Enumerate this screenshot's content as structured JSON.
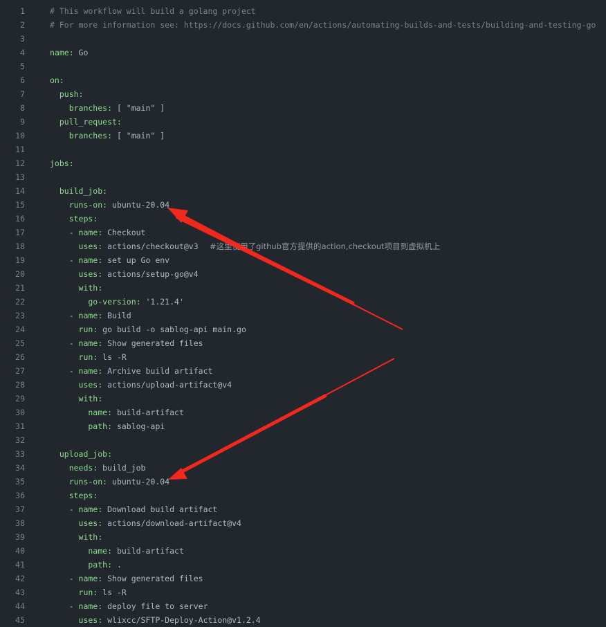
{
  "line_numbers": [
    "1",
    "2",
    "3",
    "4",
    "5",
    "6",
    "7",
    "8",
    "9",
    "10",
    "11",
    "12",
    "13",
    "14",
    "15",
    "16",
    "17",
    "18",
    "19",
    "20",
    "21",
    "22",
    "23",
    "24",
    "25",
    "26",
    "27",
    "28",
    "29",
    "30",
    "31",
    "32",
    "33",
    "34",
    "35",
    "36",
    "37",
    "38",
    "39",
    "40",
    "41",
    "42",
    "43",
    "44",
    "45"
  ],
  "code": {
    "l1": "# This workflow will build a golang project",
    "l2": "# For more information see: https://docs.github.com/en/actions/automating-builds-and-tests/building-and-testing-go",
    "l4k": "name:",
    "l4v": " Go",
    "l6k": "on:",
    "l7k": "  push:",
    "l8k": "    branches:",
    "l8v": " [ \"main\" ]",
    "l9k": "  pull_request:",
    "l10k": "    branches:",
    "l10v": " [ \"main\" ]",
    "l12k": "jobs:",
    "l14k": "  build_job:",
    "l15k": "    runs-on:",
    "l15v": " ubuntu-20.04",
    "l16k": "    steps:",
    "l17p": "    - ",
    "l17k": "name:",
    "l17v": " Checkout",
    "l18k": "      uses:",
    "l18v": " actions/checkout@v3",
    "l18note": "#这里使用了github官方提供的action,checkout项目到虚拟机上",
    "l19p": "    - ",
    "l19k": "name:",
    "l19v": " set up Go env",
    "l20k": "      uses:",
    "l20v": " actions/setup-go@v4",
    "l21k": "      with:",
    "l22k": "        go-version:",
    "l22v": " '1.21.4'",
    "l23p": "    - ",
    "l23k": "name:",
    "l23v": " Build",
    "l24k": "      run:",
    "l24v": " go build -o sablog-api main.go",
    "l25p": "    - ",
    "l25k": "name:",
    "l25v": " Show generated files",
    "l26k": "      run:",
    "l26v": " ls -R",
    "l27p": "    - ",
    "l27k": "name:",
    "l27v": " Archive build artifact",
    "l28k": "      uses:",
    "l28v": " actions/upload-artifact@v4",
    "l29k": "      with:",
    "l30k": "        name:",
    "l30v": " build-artifact",
    "l31k": "        path:",
    "l31v": " sablog-api",
    "l33k": "  upload_job:",
    "l34k": "    needs:",
    "l34v": " build_job",
    "l35k": "    runs-on:",
    "l35v": " ubuntu-20.04",
    "l36k": "    steps:",
    "l37p": "    - ",
    "l37k": "name:",
    "l37v": " Download build artifact",
    "l38k": "      uses:",
    "l38v": " actions/download-artifact@v4",
    "l39k": "      with:",
    "l40k": "        name:",
    "l40v": " build-artifact",
    "l41k": "        path:",
    "l41v": " .",
    "l42p": "    - ",
    "l42k": "name:",
    "l42v": " Show generated files",
    "l43k": "      run:",
    "l43v": " ls -R",
    "l44p": "    - ",
    "l44k": "name:",
    "l44v": " deploy file to server",
    "l45k": "      uses:",
    "l45v": " wlixcc/SFTP-Deploy-Action@v1.2.4"
  },
  "colors": {
    "background": "#22272e",
    "key": "#8ddb8c",
    "value": "#adbac7",
    "comment": "#768390",
    "arrow": "#f0281e"
  },
  "annotations": [
    "arrow-pointing-to-runs-on-line-15",
    "arrow-pointing-to-runs-on-line-35"
  ]
}
